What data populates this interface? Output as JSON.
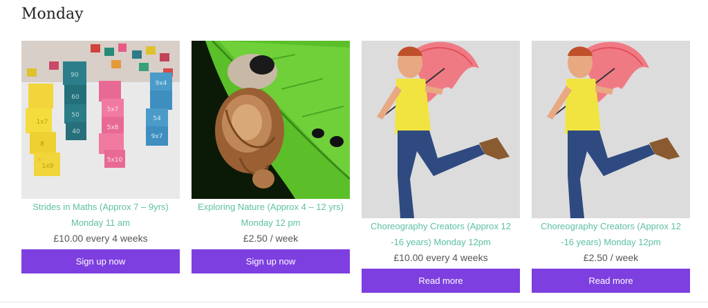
{
  "section": {
    "title": "Monday"
  },
  "products": [
    {
      "title": "Strides in Maths (Approx 7 – 9yrs) Monday 11 am",
      "price": "£10.00 every 4 weeks",
      "button": "Sign up now",
      "image": "math-blocks"
    },
    {
      "title": "Exploring Nature (Approx 4 – 12 yrs) Monday 12 pm",
      "price": "£2.50 / week",
      "button": "Sign up now",
      "image": "snail-on-leaf"
    },
    {
      "title": "Choreography Creators (Approx 12 -16 years) Monday 12pm",
      "price": "£10.00 every 4 weeks",
      "button": "Read more",
      "image": "dancer-umbrella"
    },
    {
      "title": "Choreography Creators (Approx 12 -16 years) Monday 12pm",
      "price": "£2.50 / week",
      "button": "Read more",
      "image": "dancer-umbrella"
    }
  ],
  "colors": {
    "accent": "#7e3fe0",
    "title_link": "#5bbfa4",
    "price_text": "#555555"
  }
}
